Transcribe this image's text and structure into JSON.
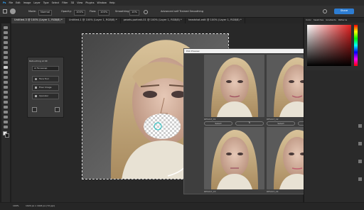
{
  "menu": [
    "Ps",
    "File",
    "Edit",
    "Image",
    "Layer",
    "Type",
    "Select",
    "Filter",
    "3D",
    "View",
    "Plugins",
    "Window",
    "Help"
  ],
  "options_bar": {
    "mode_value": "Mode:",
    "mode_select": "Normal",
    "opacity_label": "Opacity:",
    "opacity_value": "100%",
    "flow_label": "Flow:",
    "flow_value": "100%",
    "smoothing_label": "Smoothing:",
    "smoothing_value": "10%",
    "feature_text": "Advanced self Trained Smoothing",
    "share_label": "Share"
  },
  "tabs": [
    {
      "label": "Untitled-3 @ 100% (Layer 1, RGB/8) *",
      "active": true
    },
    {
      "label": "Untitled-1 @ 100% (Layer 1, RGB/8) *",
      "active": false
    },
    {
      "label": "pexels-portrait-01 @ 100% (Layer 1, RGB/8) *",
      "active": false
    },
    {
      "label": "headshot-edit @ 100% (Layer 1, RGB/8) *",
      "active": false
    }
  ],
  "float_panel": {
    "title": "Retouching AI Kit",
    "dropdown": "AI Faceswap",
    "buttons": [
      "Face Tool",
      "Fixer Image",
      "Upscaler"
    ]
  },
  "dialog": {
    "title": "Pick Preview",
    "cards": [
      {
        "label": "RESULT_01",
        "select": "Select",
        "regen": "↻"
      },
      {
        "label": "RESULT_02",
        "select": "Select",
        "regen": "↻"
      },
      {
        "label": "RESULT_03",
        "select": "Select",
        "regen": "↻"
      },
      {
        "label": "RESULT_04",
        "select": "Select",
        "regen": "↻"
      }
    ]
  },
  "right_panel": {
    "tabs": [
      "Color",
      "Swatches",
      "Gradients",
      "Patterns"
    ],
    "layers_tabs": [
      "Layers",
      "Channels",
      "Paths"
    ]
  },
  "status": {
    "zoom": "100%",
    "doc_info": "1024 px x 1024 px (72 ppi)"
  },
  "colors": {
    "accent": "#2d7dd2",
    "foreground": "#e6e6e6",
    "background": "#1a1a1a"
  }
}
